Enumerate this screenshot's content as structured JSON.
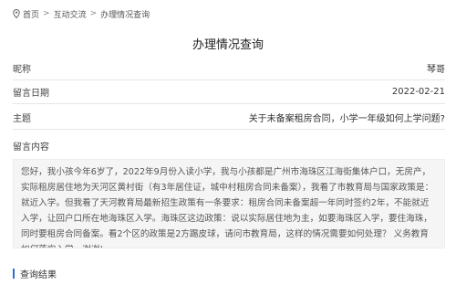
{
  "breadcrumb": {
    "home": "首页",
    "separator": ">",
    "section": "互动交流",
    "current": "办理情况查询"
  },
  "page_title": "办理情况查询",
  "fields": {
    "name_label": "昵称",
    "name_value": "琴哥",
    "date_label": "留言日期",
    "date_value": "2022-02-21",
    "topic_label": "主题",
    "topic_value": "关于未备案租房合同，小学一年级如何上学问题?",
    "content_label": "留言内容"
  },
  "content_text": "您好，我小孩今年6岁了，2022年9月份入读小学，我与小孩都是广州市海珠区江海街集体户口，无房产，实际租房居住地为天河区黄村街（有3年居住证，城中村租房合同未备案），我看了市教育局与国家政策是：就近入学。但我看了天河教育局最新招生政策有一条要求：租房合同未备案超一年同时签约2年，不能就近入学，让回户口所在地海珠区入学。海珠区这边政策：说以实际居住地为主，如要海珠区入学，要住海珠，同时要租房合同备案。看2个区的政策是2方踢皮球，请问市教育局，这样的情况需要如何处理？ 义务教育如何落实入学，谢谢!",
  "result_section": {
    "title": "查询结果",
    "accent_color": "#2f6fd0"
  },
  "icons": {
    "location": "location-pin-icon"
  }
}
